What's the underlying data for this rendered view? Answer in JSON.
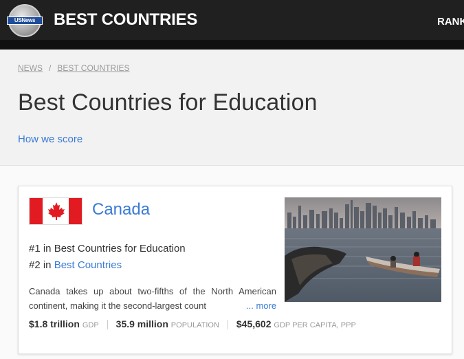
{
  "header": {
    "logo_text": "USNews",
    "site_title": "BEST COUNTRIES",
    "nav_rankings": "RANK"
  },
  "breadcrumb": {
    "items": [
      "NEWS",
      "BEST COUNTRIES"
    ],
    "separator": "/"
  },
  "page": {
    "title": "Best Countries for Education",
    "how_we_score": "How we score"
  },
  "card": {
    "country": "Canada",
    "rank_line1": "#1 in Best Countries for Education",
    "rank_line2_prefix": "#2 in ",
    "rank_line2_link": "Best Countries",
    "description": "Canada takes up about two-fifths of the North American continent, making it the second-largest count",
    "more_label": "... more",
    "stats": [
      {
        "value": "$1.8 trillion",
        "unit": "GDP"
      },
      {
        "value": "35.9 million",
        "unit": "POPULATION"
      },
      {
        "value": "$45,602",
        "unit": "GDP PER CAPITA, PPP"
      }
    ],
    "image_alt": "Toronto skyline with canoe",
    "flag_colors": {
      "red": "#e21b22",
      "white": "#ffffff"
    }
  },
  "colors": {
    "accent": "#3a7bd5",
    "header_bg": "#202020"
  }
}
